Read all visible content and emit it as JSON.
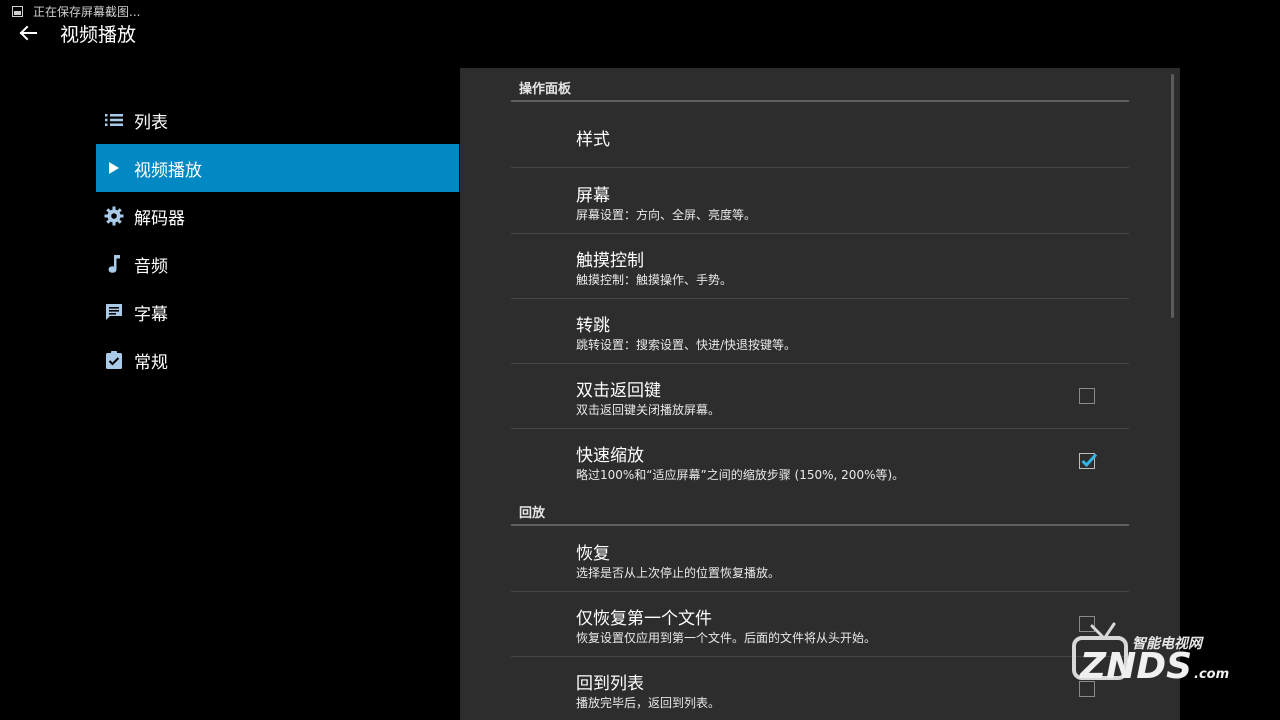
{
  "status_bar": {
    "text": "正在保存屏幕截图..."
  },
  "header": {
    "title": "视频播放"
  },
  "sidebar": {
    "items": [
      {
        "label": "列表",
        "icon": "list-icon"
      },
      {
        "label": "视频播放",
        "icon": "play-icon",
        "active": true
      },
      {
        "label": "解码器",
        "icon": "gear-icon"
      },
      {
        "label": "音频",
        "icon": "music-note-icon"
      },
      {
        "label": "字幕",
        "icon": "subtitle-message-icon"
      },
      {
        "label": "常规",
        "icon": "clipboard-check-icon"
      }
    ]
  },
  "main": {
    "sections": [
      {
        "header": "操作面板",
        "prefs": [
          {
            "title": "样式",
            "summary": ""
          },
          {
            "title": "屏幕",
            "summary": "屏幕设置：方向、全屏、亮度等。"
          },
          {
            "title": "触摸控制",
            "summary": "触摸控制：触摸操作、手势。"
          },
          {
            "title": "转跳",
            "summary": "跳转设置：搜索设置、快进/快退按键等。"
          },
          {
            "title": "双击返回键",
            "summary": "双击返回键关闭播放屏幕。",
            "checked": false
          },
          {
            "title": "快速缩放",
            "summary": "略过100%和“适应屏幕”之间的缩放步骤 (150%, 200%等)。",
            "checked": true
          }
        ]
      },
      {
        "header": "回放",
        "prefs": [
          {
            "title": "恢复",
            "summary": "选择是否从上次停止的位置恢复播放。"
          },
          {
            "title": "仅恢复第一个文件",
            "summary": "恢复设置仅应用到第一个文件。后面的文件将从头开始。",
            "checked": false
          },
          {
            "title": "回到列表",
            "summary": "播放完毕后，返回到列表。",
            "checked": false
          }
        ]
      }
    ]
  },
  "watermark": {
    "top_text": "智能电视网",
    "brand": "ZNDS",
    "suffix": ".com"
  },
  "colors": {
    "accent": "#0288c2",
    "panel": "#2d2d2d",
    "checkbox_checked": "#33b5e5"
  }
}
